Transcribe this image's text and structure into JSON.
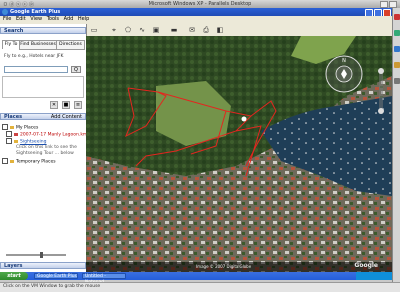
{
  "host": {
    "title": "Microsoft Windows XP - Parallels Desktop",
    "left_label": "ㅁ ⓓ ⓢ ⓒ ⓟ"
  },
  "app": {
    "title": "Google Earth Plus",
    "menu": [
      "File",
      "Edit",
      "View",
      "Tools",
      "Add",
      "Help"
    ]
  },
  "search": {
    "header": "Search",
    "tabs": [
      "Fly To",
      "Find Businesses",
      "Directions"
    ],
    "fly_label": "Fly to e.g., Hotels near JFK",
    "input_value": "",
    "go": "Q"
  },
  "places": {
    "header": "Places",
    "add_content": "Add Content",
    "items": [
      {
        "label": "My Places",
        "kind": "root"
      },
      {
        "label": "2007-07-17 Manly Lagoon.kml",
        "kind": "kml"
      },
      {
        "label": "Sightseeing",
        "kind": "link"
      },
      {
        "label": "Click on this link to see the",
        "kind": "note"
      },
      {
        "label": "Sightseeing Tour ... below",
        "kind": "note"
      },
      {
        "label": "Temporary Places",
        "kind": "root"
      }
    ]
  },
  "layers": {
    "header": "Layers"
  },
  "map": {
    "footer": "Image © 2007 DigitalGlobe",
    "brand": "Google"
  },
  "taskbar": {
    "start": "start",
    "tasks": [
      "Google Earth Plus",
      "Untitled - Notepad"
    ]
  },
  "status": {
    "text": "Click on the VM Window to grab the mouse"
  },
  "colors": {
    "track": "#e3261f",
    "water": "#1e3f56",
    "vegetation": "#3f5c2a",
    "xp_blue": "#245edb"
  }
}
